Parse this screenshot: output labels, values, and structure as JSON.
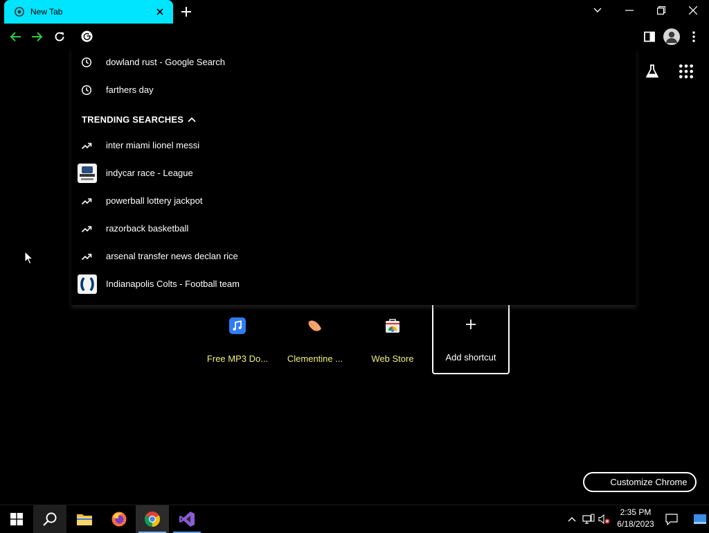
{
  "browser": {
    "tab_title": "New Tab"
  },
  "omnibox": {
    "history": [
      {
        "text": "dowland rust - Google Search",
        "icon": "clock-icon"
      },
      {
        "text": "farthers day",
        "icon": "clock-icon"
      }
    ],
    "trending_header": "TRENDING SEARCHES",
    "trending": [
      {
        "text": "inter miami lionel messi",
        "icon": "trending-icon"
      },
      {
        "text": "indycar race - League",
        "icon": "indycar-logo"
      },
      {
        "text": "powerball lottery jackpot",
        "icon": "trending-icon"
      },
      {
        "text": "razorback basketball",
        "icon": "trending-icon"
      },
      {
        "text": "arsenal transfer news declan rice",
        "icon": "trending-icon"
      },
      {
        "text": "Indianapolis Colts - Football team",
        "icon": "colts-logo"
      }
    ]
  },
  "shortcuts": [
    {
      "label": "Free MP3 Do...",
      "icon": "music-note-icon"
    },
    {
      "label": "Clementine ...",
      "icon": "clementine-icon"
    },
    {
      "label": "Web Store",
      "icon": "web-store-icon"
    },
    {
      "label": "Add shortcut",
      "icon": "plus-icon"
    }
  ],
  "customize_label": "Customize Chrome",
  "taskbar": {
    "time": "2:35 PM",
    "date": "6/18/2023"
  },
  "colors": {
    "tab_accent": "#00e5ff",
    "nav_arrows": "#2ecc40",
    "shortcut_label": "#f2f27a",
    "background": "#000000"
  }
}
